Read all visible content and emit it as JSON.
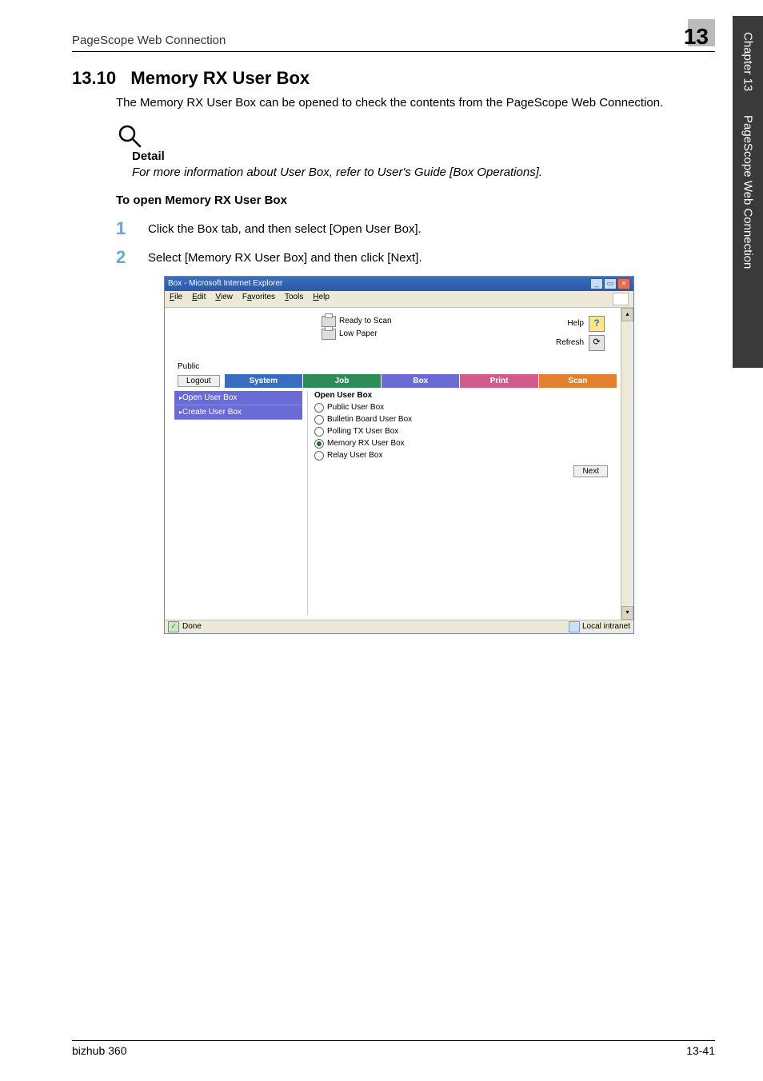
{
  "header": {
    "title": "PageScope Web Connection",
    "chapter_number": "13"
  },
  "side": {
    "chapter_label": "Chapter 13",
    "section_label": "PageScope Web Connection"
  },
  "section": {
    "number": "13.10",
    "title": "Memory RX User Box",
    "intro": "The Memory RX User Box can be opened to check the contents from the PageScope Web Connection."
  },
  "detail": {
    "label": "Detail",
    "text": "For more information about User Box, refer to User's Guide [Box Operations]."
  },
  "subheading": "To open Memory RX User Box",
  "steps": {
    "s1": {
      "num": "1",
      "text": "Click the Box tab, and then select [Open User Box]."
    },
    "s2": {
      "num": "2",
      "text": "Select [Memory RX User Box] and then click [Next]."
    }
  },
  "screenshot": {
    "window_title": "Box - Microsoft Internet Explorer",
    "menus": {
      "file": "File",
      "edit": "Edit",
      "view": "View",
      "fav": "Favorites",
      "tools": "Tools",
      "help": "Help"
    },
    "status": {
      "ready": "Ready to Scan",
      "lowpaper": "Low Paper"
    },
    "helprow": {
      "help": "Help",
      "refresh": "Refresh",
      "q": "?"
    },
    "public_label": "Public",
    "logout": "Logout",
    "tabs": {
      "system": "System",
      "job": "Job",
      "box": "Box",
      "print": "Print",
      "scan": "Scan"
    },
    "leftnav": {
      "open": "Open User Box",
      "create": "Create User Box"
    },
    "pane": {
      "title": "Open User Box",
      "opts": {
        "public": "Public User Box",
        "bulletin": "Bulletin Board User Box",
        "polling": "Polling TX User Box",
        "memory": "Memory RX User Box",
        "relay": "Relay User Box"
      },
      "next": "Next"
    },
    "statusbar": {
      "done": "Done",
      "intranet": "Local intranet"
    }
  },
  "footer": {
    "model": "bizhub 360",
    "page": "13-41"
  }
}
